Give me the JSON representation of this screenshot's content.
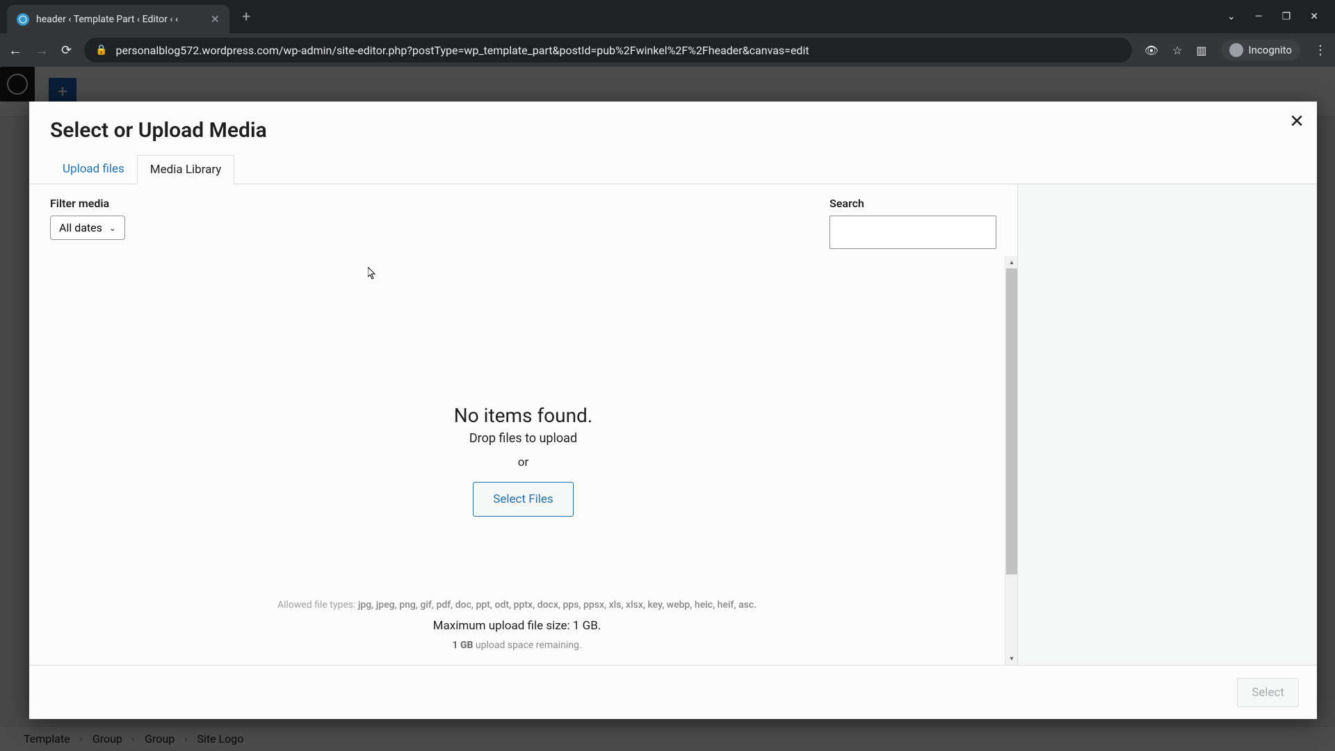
{
  "browser": {
    "tab_title": "header ‹ Template Part ‹ Editor ‹ ‹",
    "url": "personalblog572.wordpress.com/wp-admin/site-editor.php?postType=wp_template_part&postId=pub%2Fwinkel%2F%2Fheader&canvas=edit",
    "incognito_label": "Incognito"
  },
  "wp": {
    "breadcrumb": [
      "Template",
      "Group",
      "Group",
      "Site Logo"
    ]
  },
  "modal": {
    "title": "Select or Upload Media",
    "tabs": {
      "upload": "Upload files",
      "library": "Media Library"
    },
    "filter_label": "Filter media",
    "date_filter": "All dates",
    "search_label": "Search",
    "empty": {
      "no_items": "No items found.",
      "drop": "Drop files to upload",
      "or": "or",
      "select_files": "Select Files"
    },
    "allowed_prefix": "Allowed file types: ",
    "allowed_types": "jpg, jpeg, png, gif, pdf, doc, ppt, odt, pptx, docx, pps, ppsx, xls, xlsx, key, webp, heic, heif, asc.",
    "max_upload": "Maximum upload file size: 1 GB.",
    "remaining_bold": "1 GB",
    "remaining_rest": " upload space remaining.",
    "footer_select": "Select"
  }
}
